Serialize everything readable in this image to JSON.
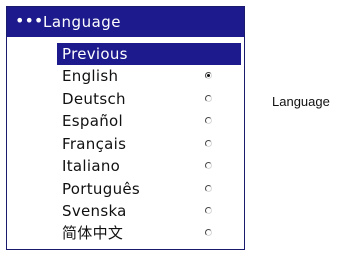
{
  "menu": {
    "header_dots": "•••",
    "title": "Language",
    "items": [
      {
        "label": "Previous",
        "selected": true,
        "radio": false
      },
      {
        "label": "English",
        "selected": false,
        "radio": true,
        "checked": true
      },
      {
        "label": "Deutsch",
        "selected": false,
        "radio": true,
        "checked": false
      },
      {
        "label": "Español",
        "selected": false,
        "radio": true,
        "checked": false
      },
      {
        "label": "Français",
        "selected": false,
        "radio": true,
        "checked": false
      },
      {
        "label": "Italiano",
        "selected": false,
        "radio": true,
        "checked": false
      },
      {
        "label": "Português",
        "selected": false,
        "radio": true,
        "checked": false
      },
      {
        "label": "Svenska",
        "selected": false,
        "radio": true,
        "checked": false
      },
      {
        "label": "简体中文",
        "selected": false,
        "radio": true,
        "checked": false
      }
    ]
  },
  "caption": "Language",
  "colors": {
    "header_bg": "#1c1a8c",
    "highlight_bg": "#1c1a8c"
  }
}
